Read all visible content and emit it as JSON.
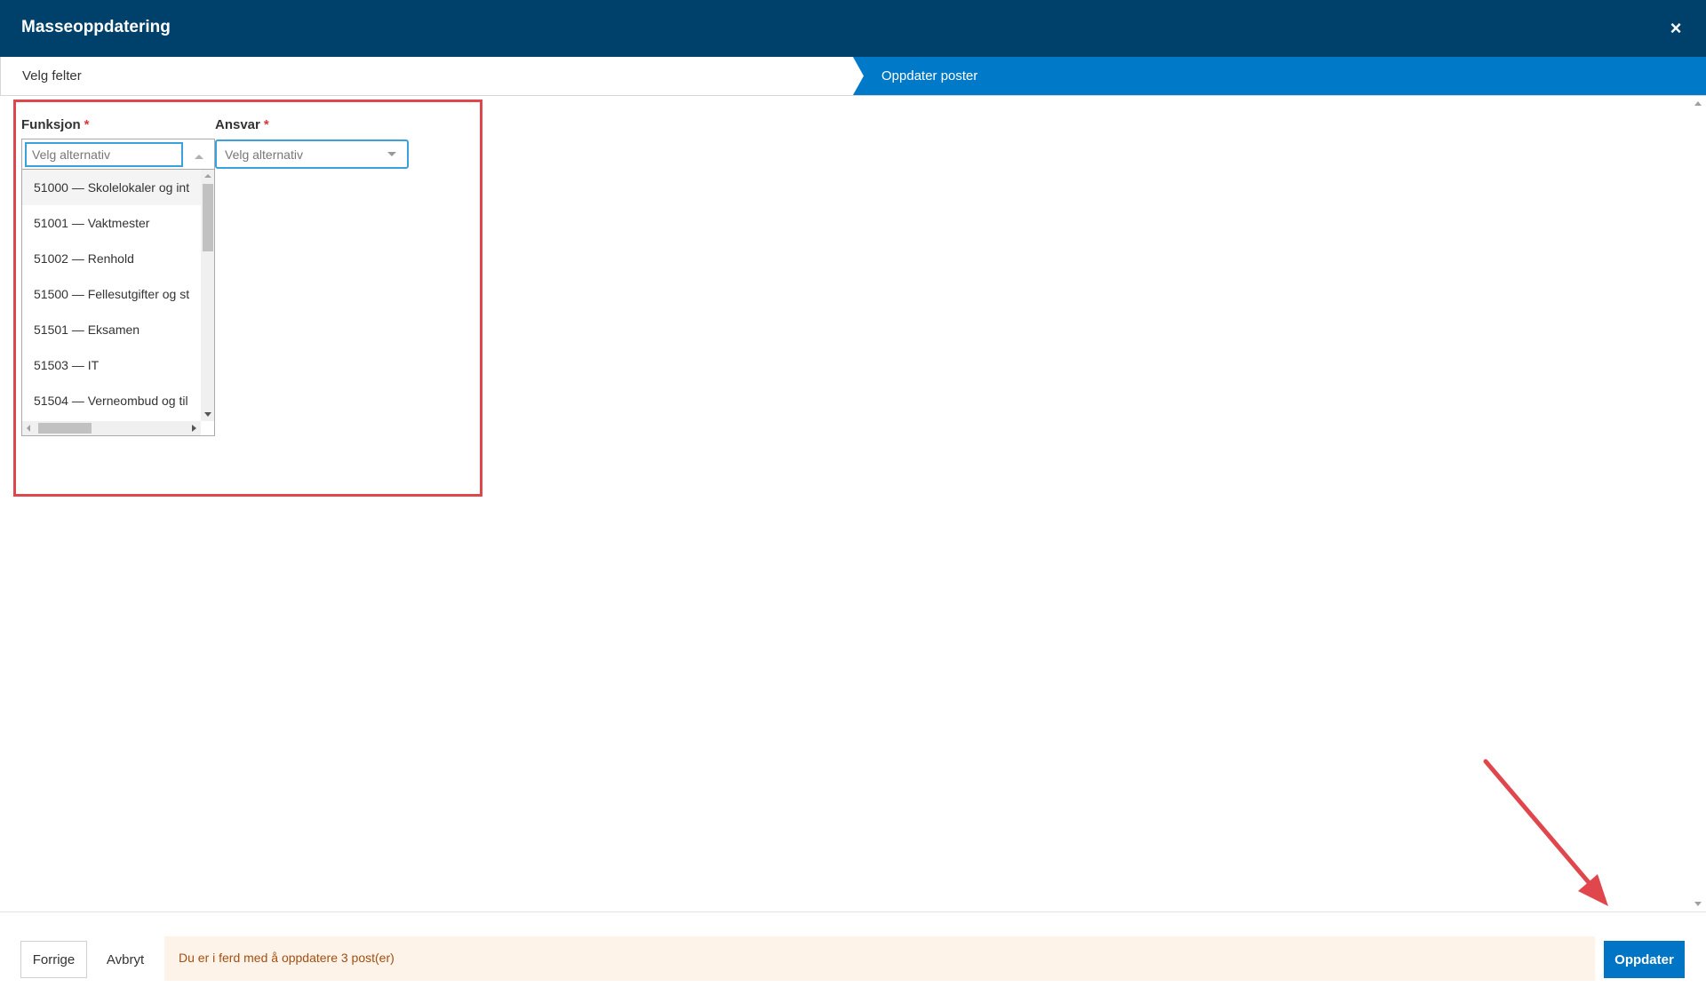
{
  "dialog": {
    "title": "Masseoppdatering",
    "close_symbol": "×"
  },
  "steps": [
    {
      "label": "Velg felter",
      "active": false
    },
    {
      "label": "Oppdater poster",
      "active": true
    }
  ],
  "form": {
    "funksjon": {
      "label": "Funksjon",
      "required_mark": "*",
      "placeholder": "Velg alternativ",
      "value": "",
      "options": [
        "51000 — Skolelokaler og int",
        "51001 — Vaktmester",
        "51002 — Renhold",
        "51500 — Fellesutgifter og st",
        "51501 — Eksamen",
        "51503 — IT",
        "51504 — Verneombud og til"
      ]
    },
    "ansvar": {
      "label": "Ansvar",
      "required_mark": "*",
      "placeholder": "Velg alternativ"
    }
  },
  "footer": {
    "prev_label": "Forrige",
    "cancel_label": "Avbryt",
    "notice": "Du er i ferd med å oppdatere 3 post(er)",
    "update_label": "Oppdater"
  },
  "colors": {
    "header_bg": "#00416b",
    "active_step": "#0079c8",
    "primary_button": "#0074c5",
    "annotation_red": "#e0474c",
    "notice_bg": "#fdf3e8",
    "notice_text": "#a34e12"
  },
  "icons": {
    "close": "close-icon",
    "dropdown_open": "chevron-up-icon",
    "dropdown_closed": "chevron-down-icon"
  }
}
